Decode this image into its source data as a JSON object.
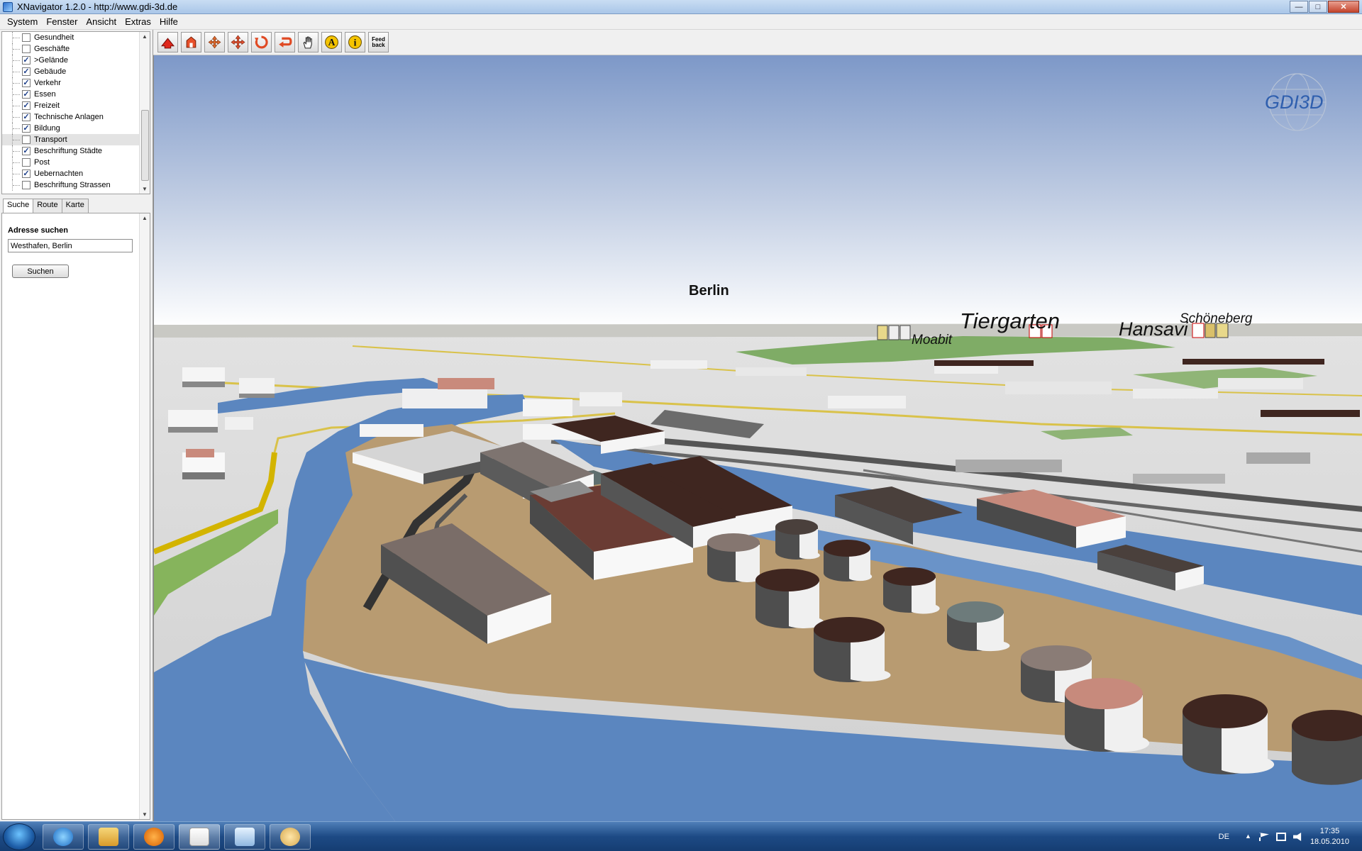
{
  "window": {
    "title": "XNavigator 1.2.0 - http://www.gdi-3d.de"
  },
  "menu": [
    "System",
    "Fenster",
    "Ansicht",
    "Extras",
    "Hilfe"
  ],
  "layers": [
    {
      "label": "Gesundheit",
      "checked": false
    },
    {
      "label": "Geschäfte",
      "checked": false
    },
    {
      "label": ">Gelände",
      "checked": true
    },
    {
      "label": "Gebäude",
      "checked": true
    },
    {
      "label": "Verkehr",
      "checked": true
    },
    {
      "label": "Essen",
      "checked": true
    },
    {
      "label": "Freizeit",
      "checked": true
    },
    {
      "label": "Technische Anlagen",
      "checked": true
    },
    {
      "label": "Bildung",
      "checked": true
    },
    {
      "label": "Transport",
      "checked": false,
      "selected": true
    },
    {
      "label": "Beschriftung Städte",
      "checked": true
    },
    {
      "label": "Post",
      "checked": false
    },
    {
      "label": "Uebernachten",
      "checked": true
    },
    {
      "label": "Beschriftung Strassen",
      "checked": false
    }
  ],
  "tabs": [
    "Suche",
    "Route",
    "Karte"
  ],
  "search": {
    "heading": "Adresse suchen",
    "value": "Westhafen, Berlin",
    "button": "Suchen"
  },
  "toolbar": {
    "feedback_label_1": "Feed",
    "feedback_label_2": "back",
    "icons": [
      "home-red-icon",
      "home-orange-icon",
      "move-arrows-icon",
      "pan-arrows-icon",
      "rotate-icon",
      "return-arrow-icon",
      "hand-icon",
      "annotation-a-icon",
      "info-icon",
      "feedback-icon"
    ]
  },
  "map": {
    "logo": "GDI3D",
    "labels": {
      "berlin": "Berlin",
      "tiergarten": "Tiergarten",
      "moabit": "Moabit",
      "hansaviertel": "Hansavi",
      "schoeneberg": "Schöneberg"
    }
  },
  "tray": {
    "language": "DE",
    "time": "17:35",
    "date": "18.05.2010"
  },
  "colors": {
    "sky_top": "#7f9bc9",
    "sky_bottom": "#ffffff",
    "water": "#5b86bf",
    "ground": "#b89b71",
    "city": "#d8d8d8",
    "building_dark": "#3f2620",
    "taskbar": "#1d4a85"
  }
}
